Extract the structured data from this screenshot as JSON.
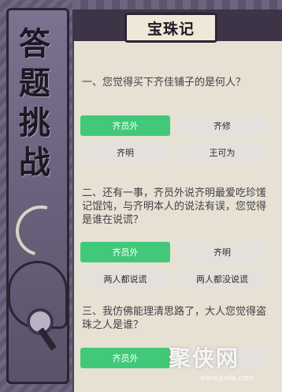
{
  "side_title": [
    "答",
    "题",
    "挑",
    "战"
  ],
  "header": {
    "title": "宝珠记"
  },
  "questions": [
    {
      "text": "一、您觉得买下齐佳铺子的是何人？",
      "options": [
        {
          "label": "齐员外",
          "selected": true
        },
        {
          "label": "齐修",
          "selected": false
        },
        {
          "label": "齐明",
          "selected": false
        },
        {
          "label": "王可为",
          "selected": false
        }
      ]
    },
    {
      "text": "二、还有一事，齐员外说齐明最爱吃珍馐记馄饨，与齐明本人的说法有误，您觉得是谁在说谎？",
      "options": [
        {
          "label": "齐员外",
          "selected": true
        },
        {
          "label": "齐明",
          "selected": false
        },
        {
          "label": "两人都说谎",
          "selected": false
        },
        {
          "label": "两人都没说谎",
          "selected": false
        }
      ]
    },
    {
      "text": "三、我仿佛能理清思路了，大人您觉得盗珠之人是谁？",
      "options": [
        {
          "label": "齐员外",
          "selected": true
        }
      ]
    }
  ],
  "watermark": {
    "text": "聚侠网",
    "url": "www.juxia.com"
  },
  "colors": {
    "selected": "#41c979",
    "option": "#e4e1dc",
    "paper": "#e6e1d3",
    "frame": "#4b4358"
  }
}
